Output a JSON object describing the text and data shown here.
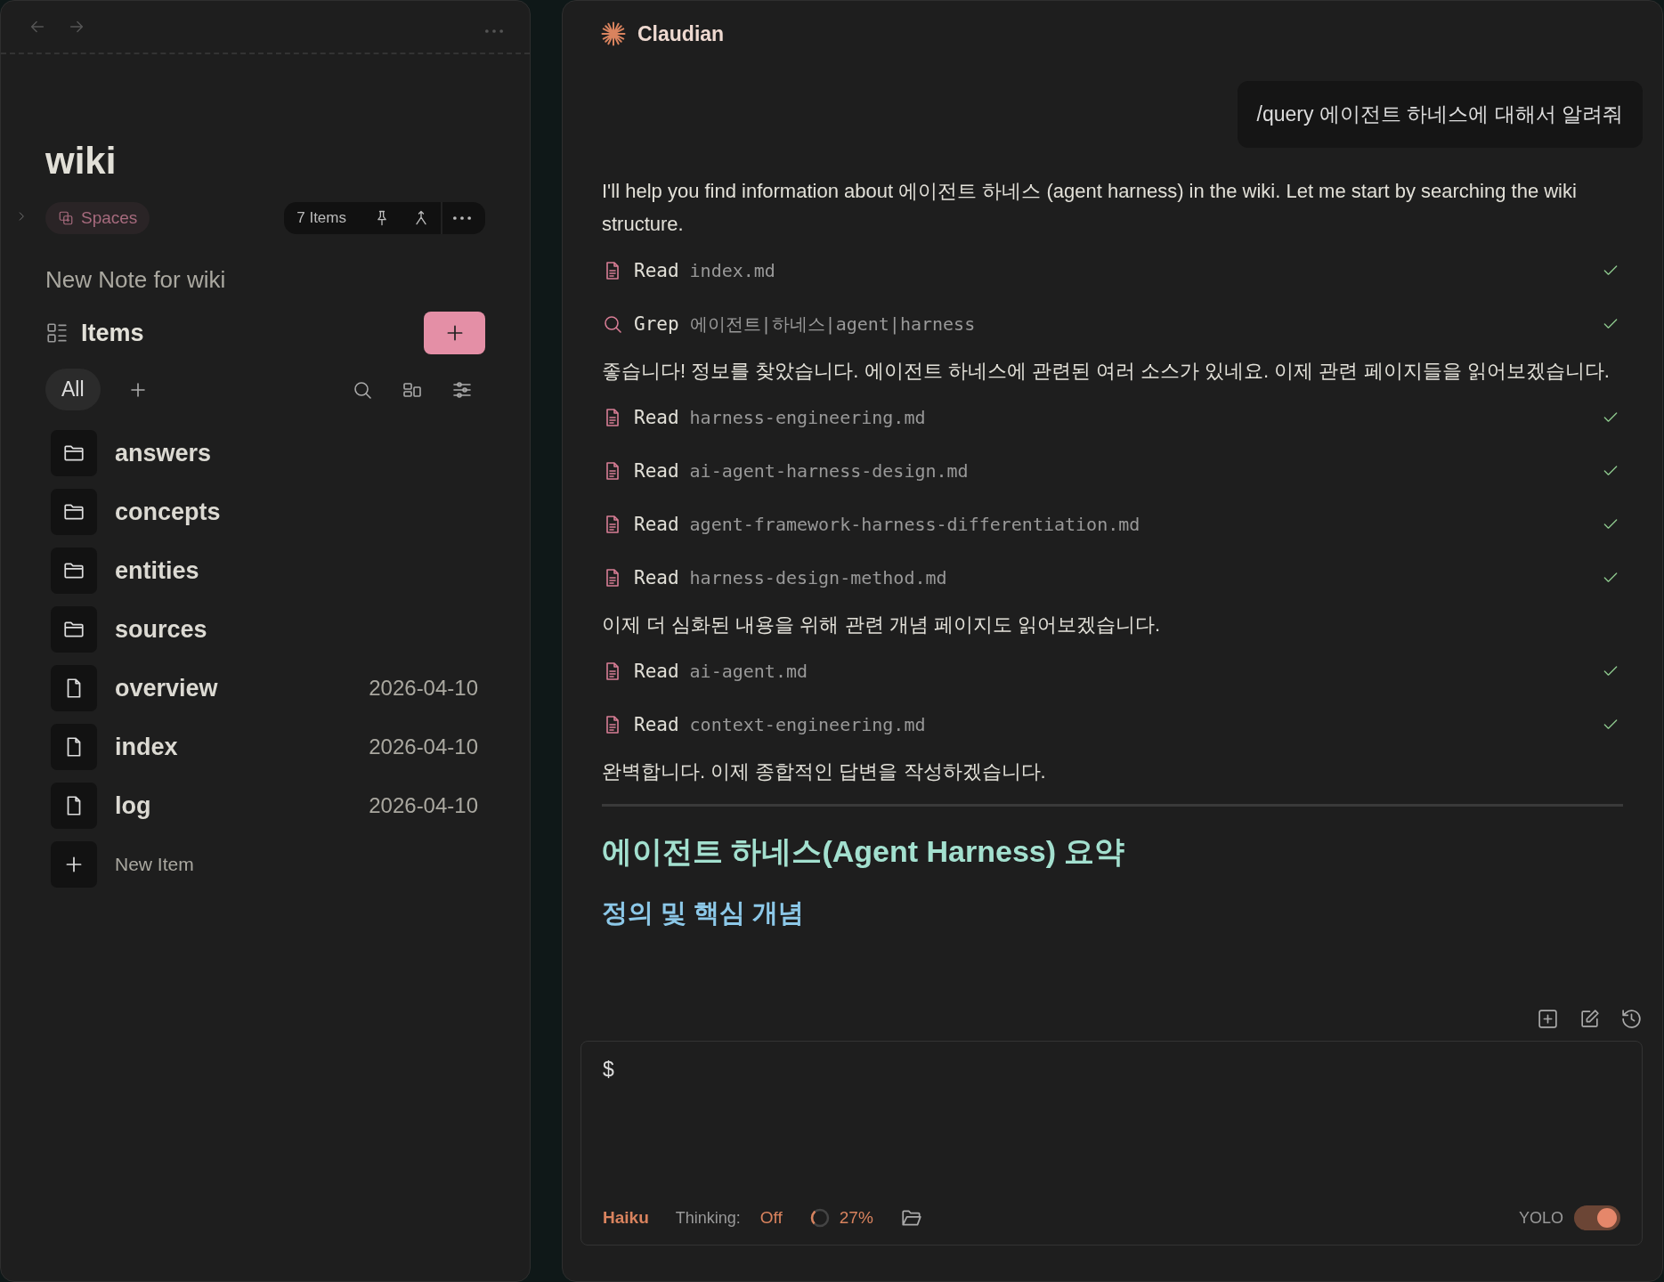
{
  "sidebar": {
    "title": "wiki",
    "spaces_chip": "Spaces",
    "item_count": "7 Items",
    "new_note": "New Note for wiki",
    "section_title": "Items",
    "filters": [
      {
        "label": "All",
        "selected": true
      }
    ],
    "items": [
      {
        "kind": "folder",
        "name": "answers"
      },
      {
        "kind": "folder",
        "name": "concepts"
      },
      {
        "kind": "folder",
        "name": "entities"
      },
      {
        "kind": "folder",
        "name": "sources"
      },
      {
        "kind": "file",
        "name": "overview",
        "date": "2026-04-10"
      },
      {
        "kind": "file",
        "name": "index",
        "date": "2026-04-10"
      },
      {
        "kind": "file",
        "name": "log",
        "date": "2026-04-10"
      }
    ],
    "new_item": "New Item"
  },
  "chat": {
    "title": "Claudian",
    "user_message": "/query 에이전트 하네스에 대해서 알려줘",
    "messages": [
      {
        "kind": "text",
        "text": "I'll help you find information about 에이전트 하네스 (agent harness) in the wiki. Let me start by searching the wiki structure."
      },
      {
        "kind": "read_tool",
        "verb": "Read",
        "arg": "index.md",
        "done": true
      },
      {
        "kind": "grep_tool",
        "verb": "Grep",
        "arg": "에이전트|하네스|agent|harness",
        "done": true
      },
      {
        "kind": "text",
        "text": "좋습니다! 정보를 찾았습니다. 에이전트 하네스에 관련된 여러 소스가 있네요. 이제 관련 페이지들을 읽어보겠습니다."
      },
      {
        "kind": "read_tool",
        "verb": "Read",
        "arg": "harness-engineering.md",
        "done": true
      },
      {
        "kind": "read_tool",
        "verb": "Read",
        "arg": "ai-agent-harness-design.md",
        "done": true
      },
      {
        "kind": "read_tool",
        "verb": "Read",
        "arg": "agent-framework-harness-differentiation.md",
        "done": true
      },
      {
        "kind": "read_tool",
        "verb": "Read",
        "arg": "harness-design-method.md",
        "done": true
      },
      {
        "kind": "text",
        "text": "이제 더 심화된 내용을 위해 관련 개념 페이지도 읽어보겠습니다."
      },
      {
        "kind": "read_tool",
        "verb": "Read",
        "arg": "ai-agent.md",
        "done": true
      },
      {
        "kind": "read_tool",
        "verb": "Read",
        "arg": "context-engineering.md",
        "done": true
      },
      {
        "kind": "text",
        "text": "완벽합니다. 이제 종합적인 답변을 작성하겠습니다."
      },
      {
        "kind": "rule"
      },
      {
        "kind": "h2",
        "text": "에이전트 하네스(Agent Harness) 요약"
      },
      {
        "kind": "h3",
        "text": "정의 및 핵심 개념"
      }
    ]
  },
  "composer": {
    "value": "$",
    "model": "Haiku",
    "thinking_label": "Thinking:",
    "thinking_value": "Off",
    "context": {
      "level": 0.27,
      "reading": "27%"
    },
    "yolo": {
      "label": "YOLO",
      "on": true
    }
  }
}
